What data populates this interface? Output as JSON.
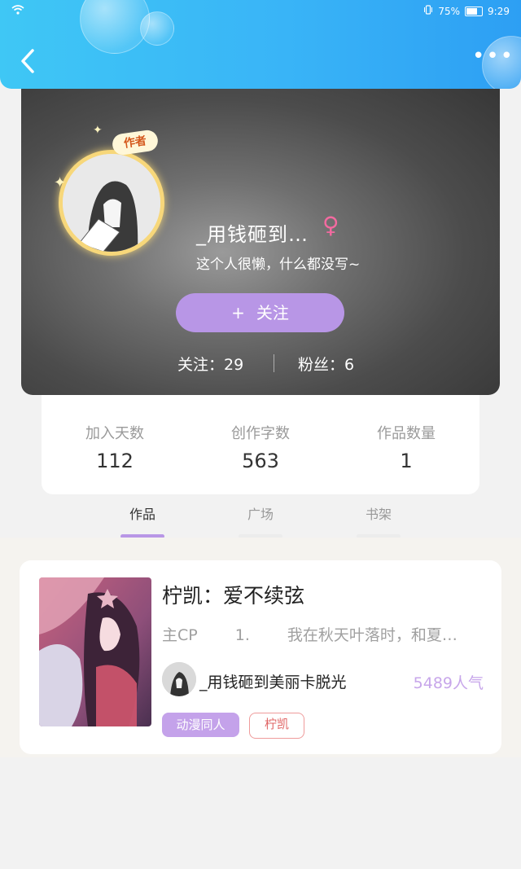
{
  "status_bar": {
    "battery": "75%",
    "time": "9:29"
  },
  "header": {
    "more_label": "•••"
  },
  "profile": {
    "badge": "作者",
    "username": "_用钱砸到…",
    "gender_symbol": "♀",
    "bio": "这个人很懒，什么都没写~",
    "follow_plus": "+",
    "follow_label": "关注",
    "following_text": "关注：29",
    "fans_text": "粉丝：6"
  },
  "stats": [
    {
      "label": "加入天数",
      "value": "112"
    },
    {
      "label": "创作字数",
      "value": "563"
    },
    {
      "label": "作品数量",
      "value": "1"
    }
  ],
  "tabs": [
    {
      "label": "作品",
      "active": true
    },
    {
      "label": "广场",
      "active": false
    },
    {
      "label": "书架",
      "active": false
    }
  ],
  "work": {
    "title": "柠凯：爱不续弦",
    "desc_part1": "主CP",
    "desc_part2": "1.",
    "desc_part3": "我在秋天叶落时，和夏…",
    "author": "_用钱砸到美丽卡脱光",
    "popularity": "5489人气",
    "tags": [
      "动漫同人",
      "柠凯"
    ]
  },
  "colors": {
    "header_blue": "#39b4f7",
    "accent_purple": "#b896e6",
    "gender_pink": "#f36aa0"
  }
}
